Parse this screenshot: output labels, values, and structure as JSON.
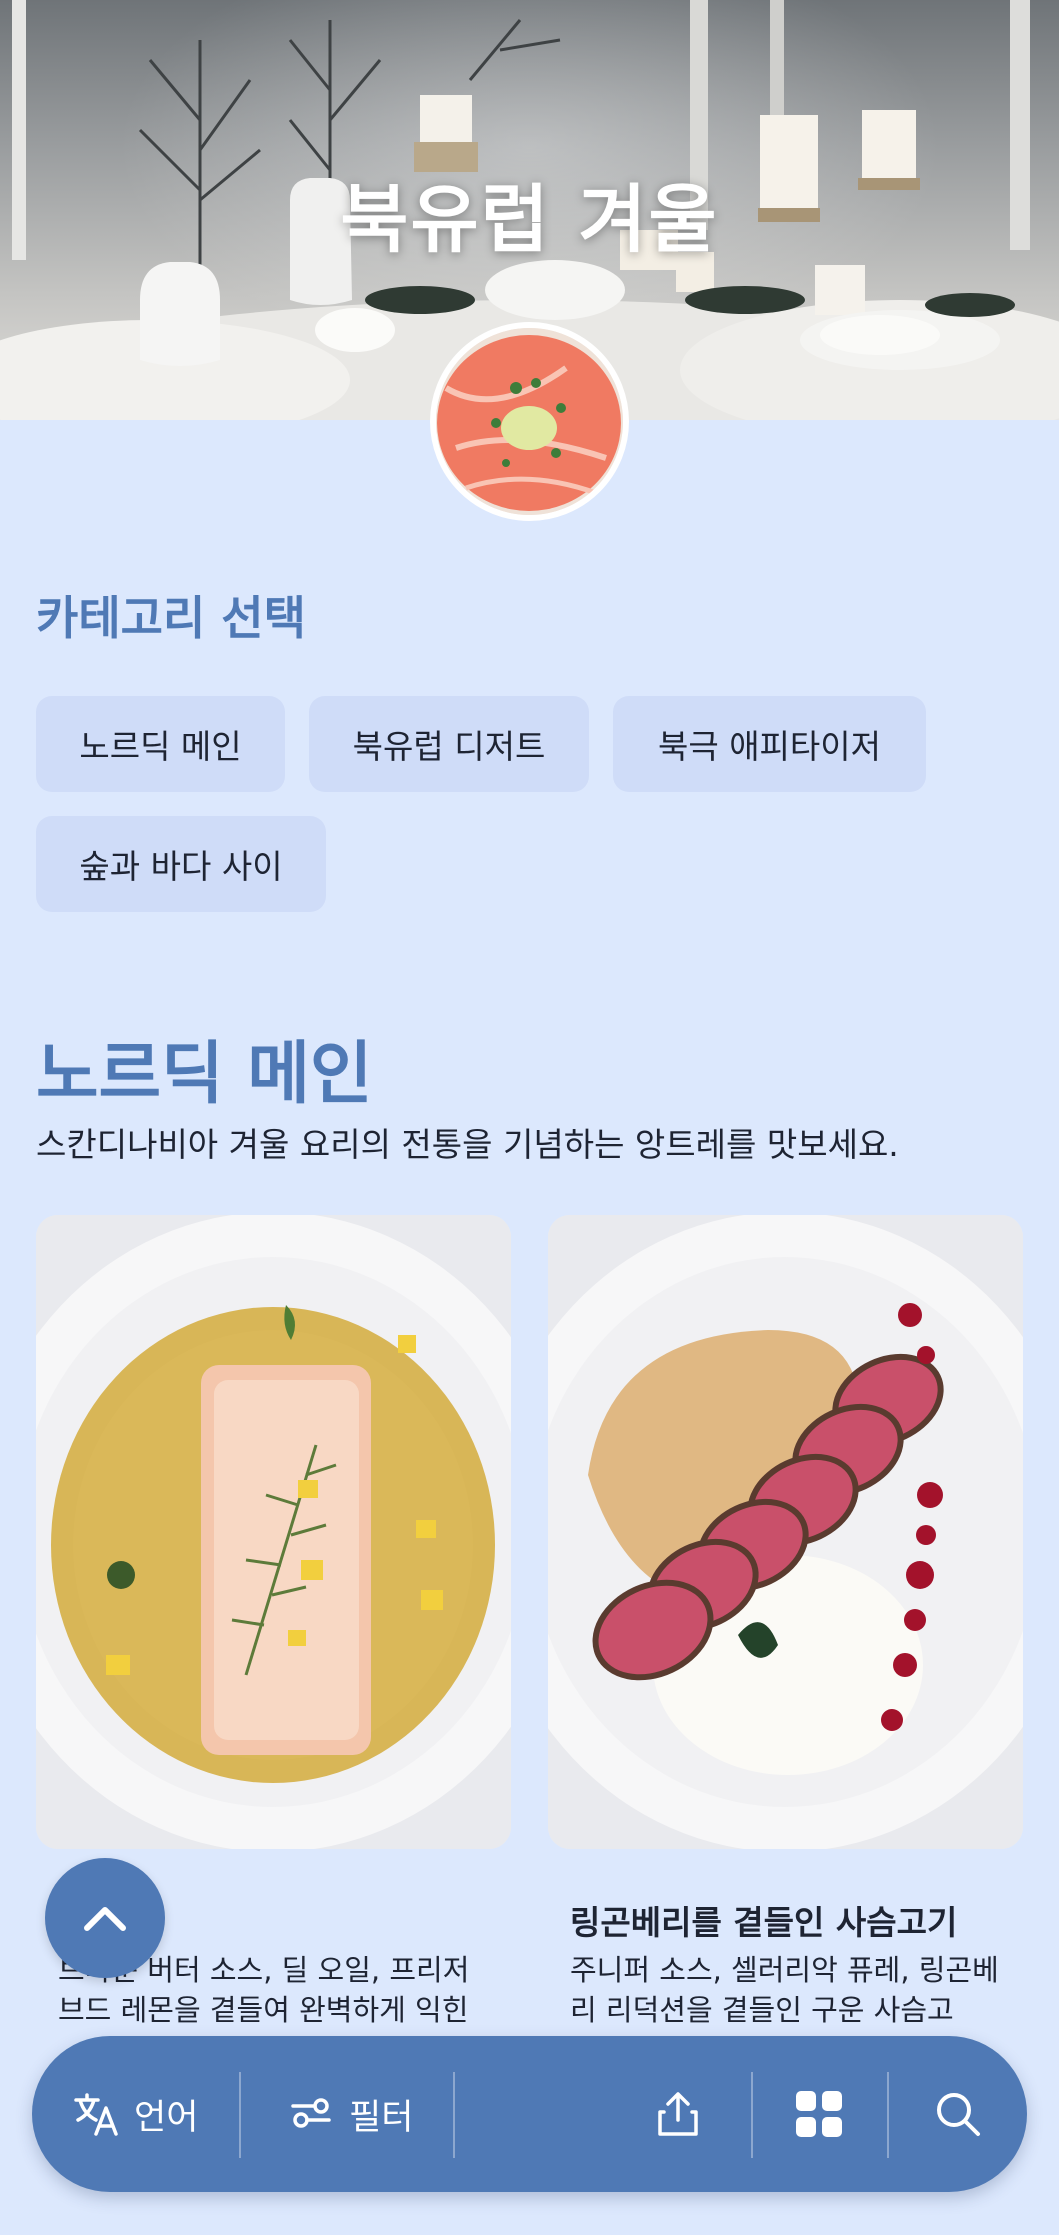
{
  "hero": {
    "title": "북유럽 겨울",
    "image": "winter-table-candles",
    "avatar_image": "salmon-tartare"
  },
  "category": {
    "heading": "카테고리 선택",
    "chips": [
      {
        "label": "노르딕 메인"
      },
      {
        "label": "북유럽 디저트"
      },
      {
        "label": "북극 애피타이저"
      },
      {
        "label": "숲과 바다 사이"
      }
    ]
  },
  "section": {
    "title": "노르딕 메인",
    "description": "스칸디나비아 겨울 요리의 전통을 기념하는 앙트레를 맛보세요.",
    "dishes": [
      {
        "title": "",
        "description": "브라운 버터 소스, 딜 오일, 프리저브드 레몬을 곁들여 완벽하게 익힌 ...",
        "image": "cod-brown-butter"
      },
      {
        "title": "링곤베리를 곁들인 사슴고기",
        "description": "주니퍼 소스, 셀러리악 퓨레, 링곤베리 리덕션을 곁들인 구운 사슴고기...",
        "image": "venison-lingonberry"
      }
    ]
  },
  "bottom_bar": {
    "language_label": "언어",
    "filter_label": "필터",
    "icons": [
      "translate-icon",
      "filter-icon",
      "share-icon",
      "grid-icon",
      "search-icon"
    ]
  },
  "colors": {
    "background": "#dce8fd",
    "accent": "#4f79b5",
    "chip": "#cfdcf8"
  }
}
